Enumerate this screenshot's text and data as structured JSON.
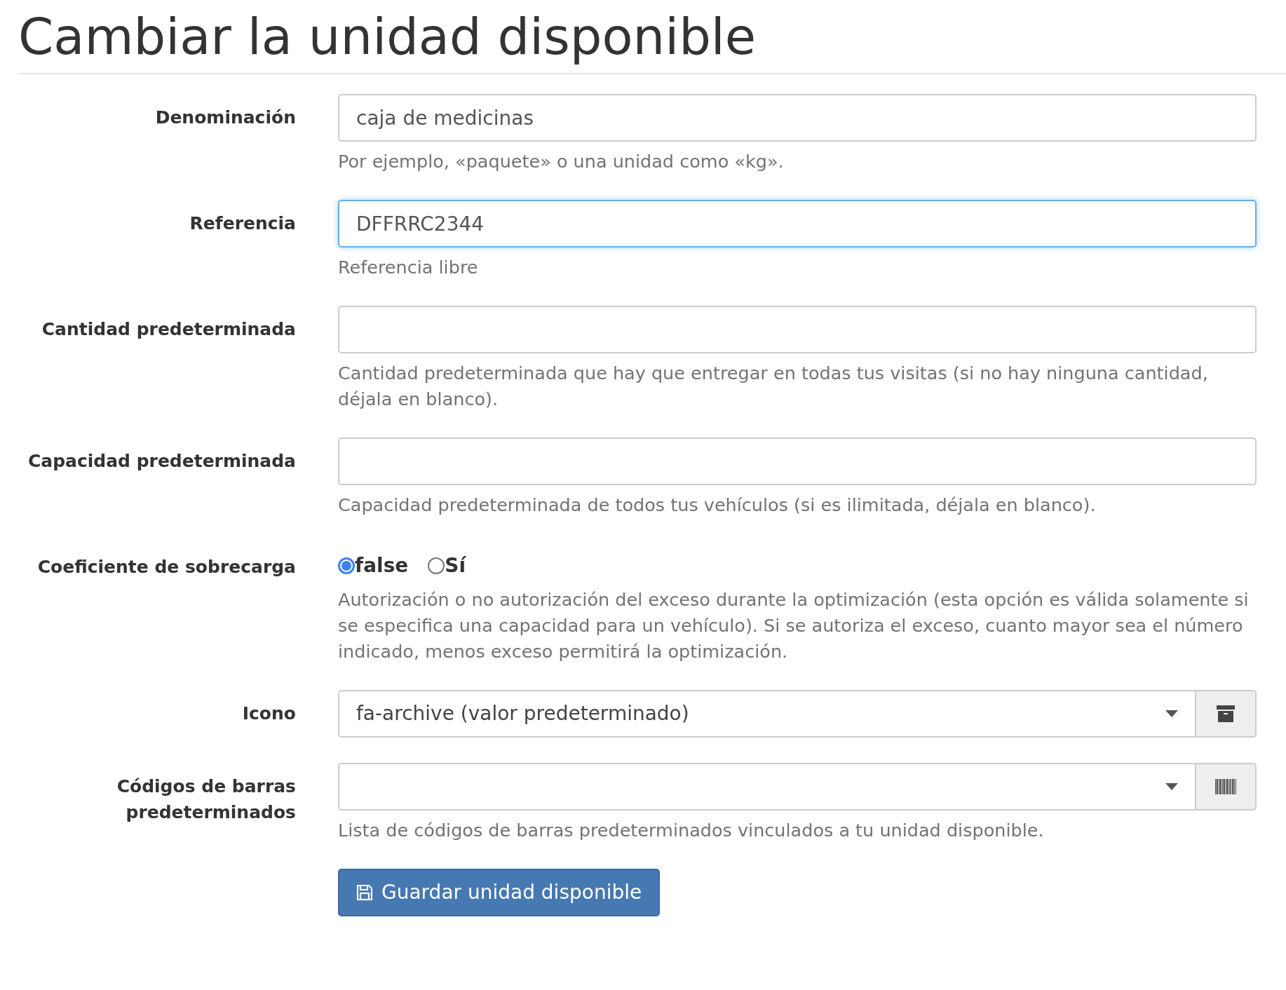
{
  "title": "Cambiar la unidad disponible",
  "fields": [
    {
      "kind": "text",
      "label": "Denominación",
      "value": "caja de medicinas",
      "focused": false,
      "help": "Por ejemplo, «paquete» o una unidad como «kg»."
    },
    {
      "kind": "text",
      "label": "Referencia",
      "value": "DFFRRC2344",
      "focused": true,
      "help": "Referencia libre"
    },
    {
      "kind": "text",
      "label": "Cantidad predeterminada",
      "focused": false,
      "help": "Cantidad predeterminada que hay que entregar en todas tus visitas (si no hay ninguna cantidad, déjala en blanco)."
    },
    {
      "kind": "text",
      "label": "Capacidad predeterminada",
      "focused": false,
      "help": "Capacidad predeterminada de todos tus vehículos (si es ilimitada, déjala en blanco)."
    },
    {
      "kind": "radio",
      "label": "Coeficiente de sobrecarga",
      "options": [
        {
          "label": "false",
          "selected": true
        },
        {
          "label": "Sí",
          "selected": false
        }
      ],
      "help": "Autorización o no autorización del exceso durante la optimización (esta opción es válida solamente si se especifica una capacidad para un vehículo). Si se autoriza el exceso, cuanto mayor sea el número indicado, menos exceso permitirá la optimización."
    },
    {
      "kind": "iconselect",
      "label": "Icono",
      "value": "fa-archive (valor predeterminado)"
    },
    {
      "kind": "barcodeselect",
      "label": "Códigos de barras predeterminados",
      "help": "Lista de códigos de barras predeterminados vinculados a tu unidad disponible."
    }
  ],
  "save_button": "Guardar unidad disponible"
}
